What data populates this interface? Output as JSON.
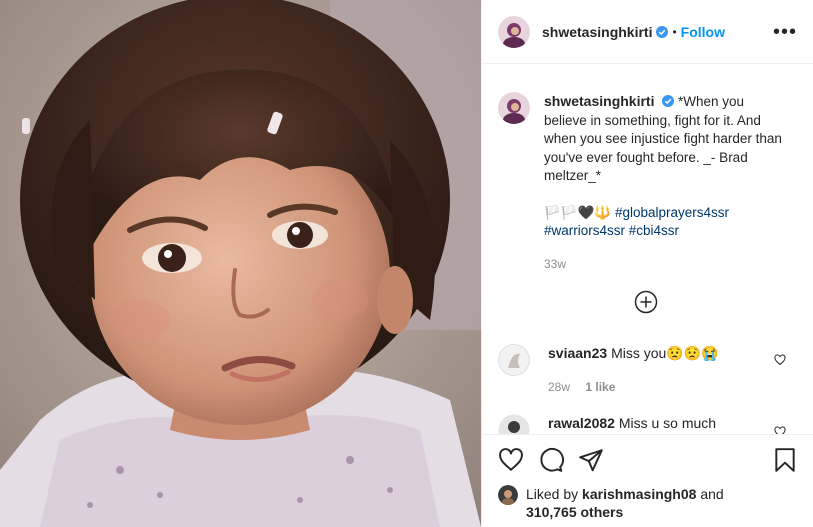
{
  "post": {
    "author": "shwetasinghkirti",
    "follow_label": "Follow",
    "separator": "•",
    "more_label": "•••"
  },
  "caption": {
    "author": "shwetasinghkirti",
    "text": "*When you believe in something, fight for it. And when you see injustice fight harder than you've ever fought before. _- Brad meltzer_*",
    "emoji_prefix": "🏳️🏳️🖤🔱 ",
    "hashtags": [
      "#globalprayers4ssr",
      "#warriors4ssr",
      "#cbi4ssr"
    ],
    "time": "33w"
  },
  "comments": [
    {
      "user": "sviaan23",
      "text": "Miss you😟😟😭",
      "time": "28w",
      "likes": "1 like"
    },
    {
      "user": "rawal2082",
      "text": "Miss u so much"
    }
  ],
  "likes": {
    "prefix": "Liked by",
    "user": "karishmasingh08",
    "conjunction": "and",
    "count": "310,765 others"
  },
  "icons": {
    "verified": "verified-badge-icon",
    "more": "more-options-icon",
    "load_more": "plus-circle-icon",
    "like": "heart-icon",
    "comment": "comment-icon",
    "share": "share-icon",
    "save": "bookmark-icon"
  },
  "colors": {
    "accent": "#0095f6",
    "text": "#262626",
    "muted": "#8e8e8e",
    "hashtag": "#00376b",
    "border": "#efefef"
  }
}
